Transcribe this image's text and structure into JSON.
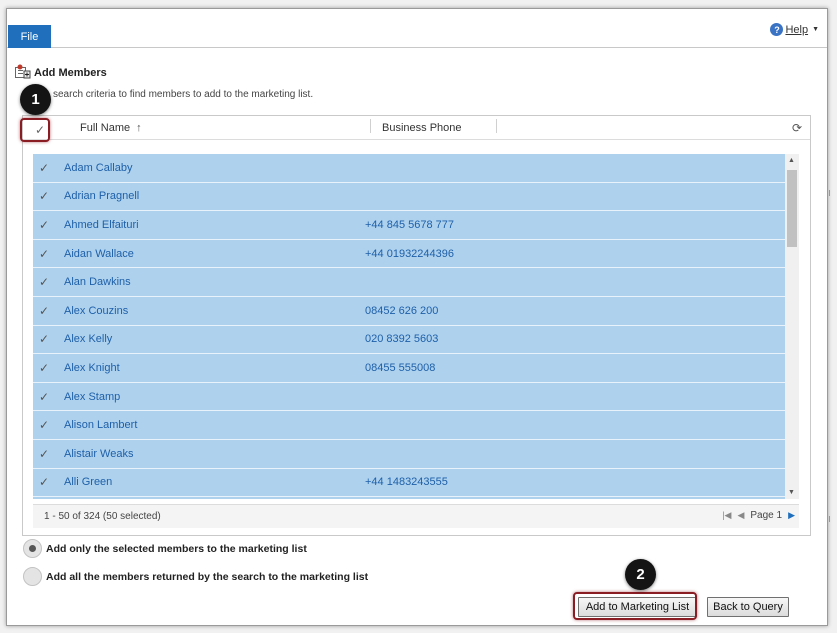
{
  "toolbar": {
    "file_label": "File",
    "help_label": "Help"
  },
  "header": {
    "title": "Add Members",
    "instructions": "search criteria to find members to add to the marketing list."
  },
  "grid": {
    "columns": {
      "full_name": "Full Name",
      "business_phone": "Business Phone"
    },
    "rows": [
      {
        "name": "Adam Callaby",
        "phone": ""
      },
      {
        "name": "Adrian Pragnell",
        "phone": ""
      },
      {
        "name": "Ahmed Elfaituri",
        "phone": "+44 845 5678 777"
      },
      {
        "name": "Aidan Wallace",
        "phone": "+44 01932244396"
      },
      {
        "name": "Alan Dawkins",
        "phone": ""
      },
      {
        "name": "Alex Couzins",
        "phone": "08452 626 200"
      },
      {
        "name": "Alex Kelly",
        "phone": "020 8392 5603"
      },
      {
        "name": "Alex Knight",
        "phone": "08455 555008"
      },
      {
        "name": "Alex Stamp",
        "phone": ""
      },
      {
        "name": "Alison Lambert",
        "phone": ""
      },
      {
        "name": "Alistair Weaks",
        "phone": ""
      },
      {
        "name": "Alli Green",
        "phone": "+44 1483243555"
      }
    ],
    "status": "1 - 50 of 324 (50 selected)",
    "page_label": "Page 1"
  },
  "options": {
    "selected_only": "Add only the selected members to the marketing list",
    "all_returned": "Add all the members returned by the search to the marketing list",
    "selected_value": "selected_only"
  },
  "buttons": {
    "add": "Add to Marketing List",
    "back": "Back to Query"
  },
  "callouts": {
    "one": "1",
    "two": "2"
  },
  "colors": {
    "accent": "#1f6fbd",
    "row_selected": "#aed2ee",
    "callout_ring": "#8a1c24"
  }
}
